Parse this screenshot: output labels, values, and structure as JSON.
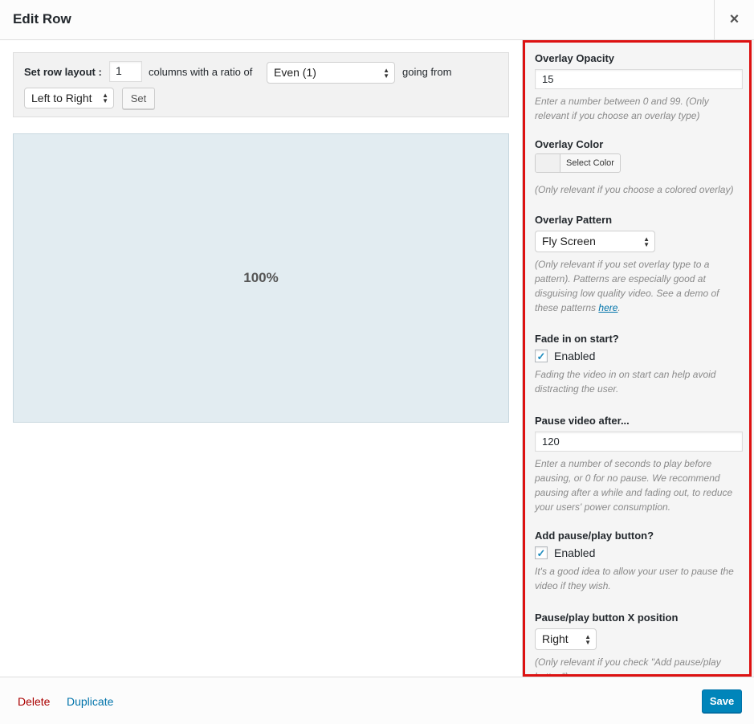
{
  "title": "Edit Row",
  "close_glyph": "×",
  "layout": {
    "label": "Set row layout :",
    "columns_value": "1",
    "text_mid": "columns with a ratio of",
    "ratio_value": "Even (1)",
    "text_end": "going from",
    "direction_value": "Left to Right",
    "set_label": "Set"
  },
  "preview": {
    "cell_label": "100%"
  },
  "settings": {
    "opacity": {
      "label": "Overlay Opacity",
      "value": "15",
      "desc": "Enter a number between 0 and 99. (Only relevant if you choose an overlay type)"
    },
    "color": {
      "label": "Overlay Color",
      "button": "Select Color",
      "desc": "(Only relevant if you choose a colored overlay)"
    },
    "pattern": {
      "label": "Overlay Pattern",
      "value": "Fly Screen",
      "desc_before": "(Only relevant if you set overlay type to a pattern). Patterns are especially good at disguising low quality video. See a demo of these patterns ",
      "link": "here",
      "desc_after": "."
    },
    "fade": {
      "label": "Fade in on start?",
      "check_label": "Enabled",
      "desc": "Fading the video in on start can help avoid distracting the user."
    },
    "pause": {
      "label": "Pause video after...",
      "value": "120",
      "desc": "Enter a number of seconds to play before pausing, or 0 for no pause. We recommend pausing after a while and fading out, to reduce your users' power consumption."
    },
    "playbtn": {
      "label": "Add pause/play button?",
      "check_label": "Enabled",
      "desc": "It's a good idea to allow your user to pause the video if they wish."
    },
    "xpos": {
      "label": "Pause/play button X position",
      "value": "Right",
      "desc": "(Only relevant if you check \"Add pause/play button\")"
    }
  },
  "footer": {
    "delete": "Delete",
    "duplicate": "Duplicate",
    "save": "Save"
  },
  "colors": {
    "highlight_border": "#dd1111",
    "primary": "#0085ba",
    "delete": "#aa0000",
    "link": "#0073aa"
  },
  "icons": {
    "check": "check-icon",
    "close": "close-icon",
    "select_arrows": "select-arrows-icon"
  }
}
